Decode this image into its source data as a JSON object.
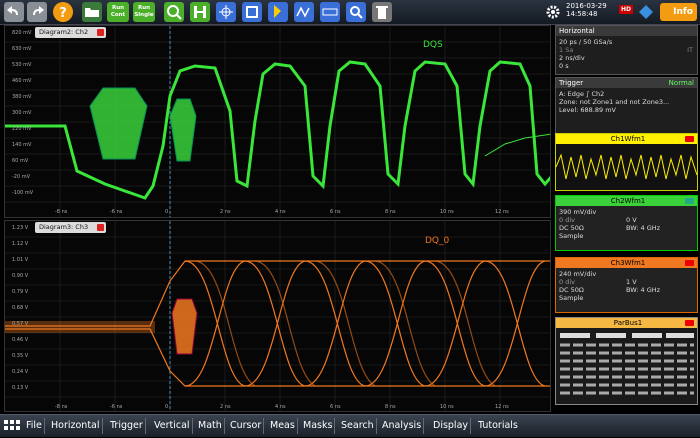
{
  "toolbar": {
    "datetime_line1": "2016-03-29",
    "datetime_line2": "14:58:48",
    "hd_badge": "HD",
    "info_label": "Info",
    "buttons": [
      {
        "icon": "undo-icon",
        "label": ""
      },
      {
        "icon": "redo-icon",
        "label": ""
      },
      {
        "icon": "help-icon",
        "label": ""
      },
      {
        "icon": "open-folder-icon",
        "label": ""
      },
      {
        "icon": "run-cont-icon",
        "label": "Run\nCont"
      },
      {
        "icon": "run-single-icon",
        "label": "Run\nSingle"
      },
      {
        "icon": "zoom-icon",
        "label": ""
      },
      {
        "icon": "histogram-icon",
        "label": ""
      },
      {
        "icon": "mask-icon",
        "label": ""
      },
      {
        "icon": "marker-icon",
        "label": ""
      },
      {
        "icon": "cursor-icon",
        "label": ""
      },
      {
        "icon": "measure-icon",
        "label": ""
      },
      {
        "icon": "search-icon",
        "label": ""
      },
      {
        "icon": "trash-icon",
        "label": ""
      }
    ]
  },
  "diagram2": {
    "title": "Diagram2: Ch2",
    "trace_label": "DQS",
    "y_ticks": [
      "820 mV",
      "630 mV",
      "530 mV",
      "460 mV",
      "380 mV",
      "300 mV",
      "220 mV",
      "140 mV",
      "60 mV",
      "-20 mV",
      "-100 mV",
      "-180 mV"
    ],
    "x_ticks": [
      "-8 ns",
      "-6 ns",
      "-4 ns",
      "0",
      "2 ns",
      "4 ns",
      "6 ns",
      "8 ns",
      "10 ns",
      "12 ns"
    ]
  },
  "diagram3": {
    "title": "Diagram3: Ch3",
    "trace_label": "DQ_0",
    "y_ticks": [
      "1.23 V",
      "1.12 V",
      "1.01 V",
      "0.90 V",
      "0.79 V",
      "0.68 V",
      "0.57 V",
      "0.46 V",
      "0.35 V",
      "0.24 V",
      "0.13 V",
      "0.02 V"
    ],
    "x_ticks": [
      "-8 ns",
      "-6 ns",
      "-4 ns",
      "0",
      "2 ns",
      "4 ns",
      "6 ns",
      "8 ns",
      "10 ns",
      "12 ns"
    ]
  },
  "horizontal": {
    "title": "Horizontal",
    "line1": "20 ps / 50 GSa/s",
    "line2": "1 Sa",
    "line2_right": "IT",
    "line3": "2 ns/div",
    "line4": "0 s"
  },
  "trigger": {
    "title": "Trigger",
    "mode": "Normal",
    "source_line": "A:        Edge    ∫ Ch2",
    "zone_line": "Zone: not Zone1 and not Zone3...",
    "level_line": "Level: 688.89 mV"
  },
  "ch1": {
    "title": "Ch1Wfm1"
  },
  "ch2": {
    "title": "Ch2Wfm1",
    "scale": "390 mV/div",
    "offset": "0 div",
    "pos": "0 V",
    "coupling": "DC 50Ω",
    "bw": "BW: 4 GHz",
    "mode": "Sample"
  },
  "ch3": {
    "title": "Ch3Wfm1",
    "scale": "240 mV/div",
    "offset": "0 div",
    "pos": "1 V",
    "coupling": "DC 50Ω",
    "bw": "BW: 4 GHz",
    "mode": "Sample"
  },
  "parbus": {
    "title": "ParBus1"
  },
  "menu": [
    "File",
    "Horizontal",
    "Trigger",
    "Vertical",
    "Math",
    "Cursor",
    "Meas",
    "Masks",
    "Search",
    "Analysis",
    "Display",
    "Tutorials"
  ],
  "colors": {
    "ch2": "#3ae63a",
    "ch3": "#f07820",
    "ch1": "#ffef00",
    "accent": "#f39c12"
  }
}
